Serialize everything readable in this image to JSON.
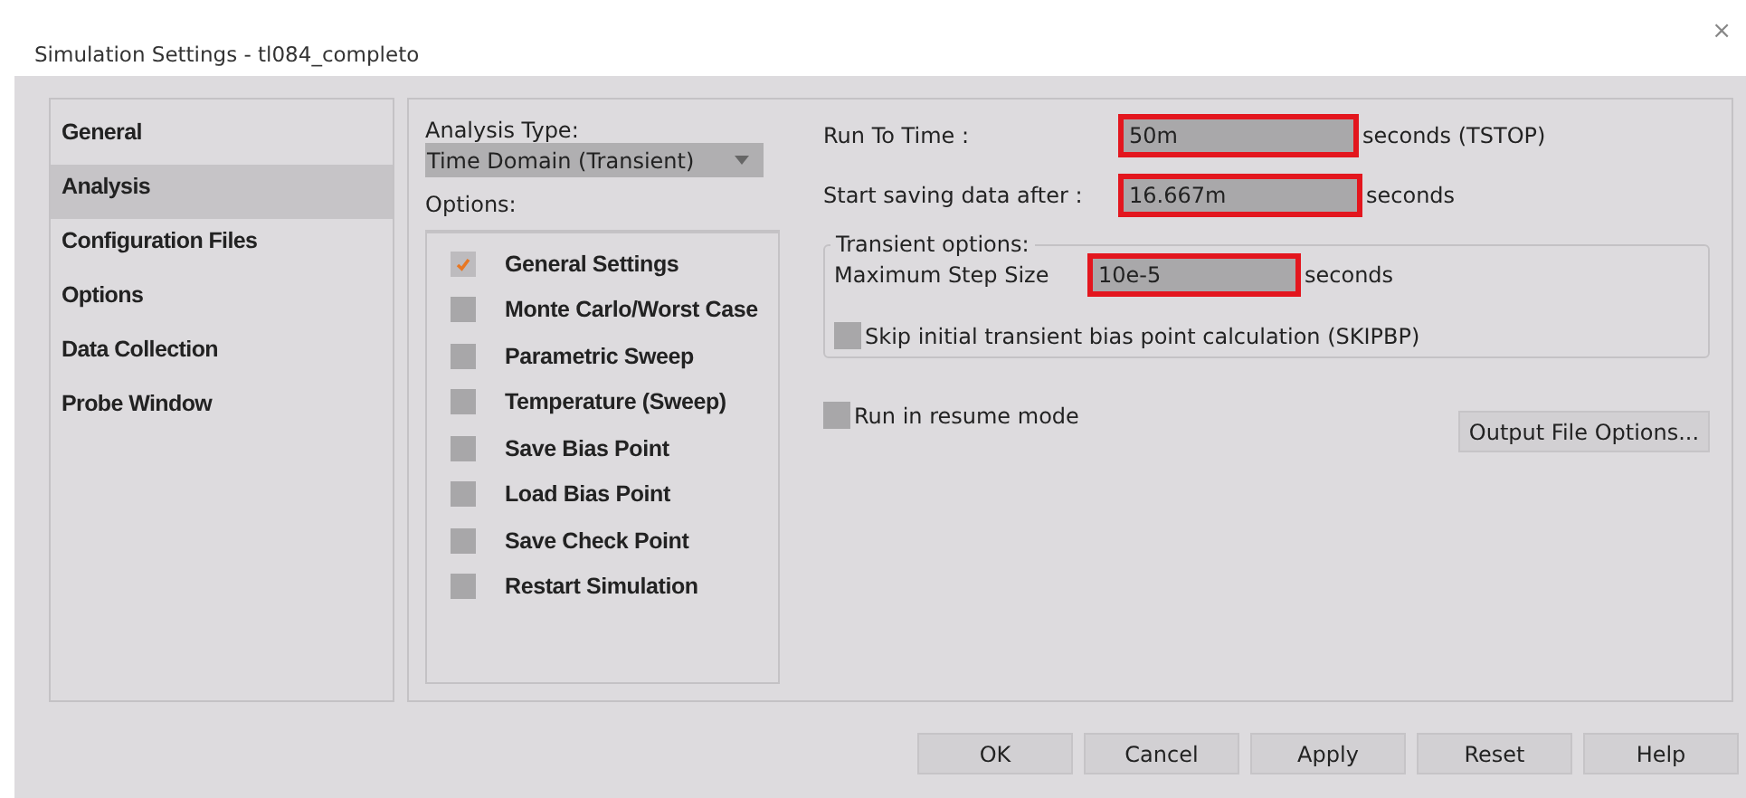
{
  "window": {
    "title": "Simulation Settings - tl084_completo",
    "close": "×"
  },
  "sidebar": {
    "items": [
      {
        "label": "General",
        "selected": false
      },
      {
        "label": "Analysis",
        "selected": true
      },
      {
        "label": "Configuration Files",
        "selected": false
      },
      {
        "label": "Options",
        "selected": false
      },
      {
        "label": "Data Collection",
        "selected": false
      },
      {
        "label": "Probe Window",
        "selected": false
      }
    ]
  },
  "analysis_type": {
    "label": "Analysis Type:",
    "value": "Time Domain (Transient)"
  },
  "options": {
    "label": "Options:",
    "items": [
      {
        "label": "General Settings",
        "checked": true
      },
      {
        "label": "Monte Carlo/Worst Case",
        "checked": false
      },
      {
        "label": "Parametric Sweep",
        "checked": false
      },
      {
        "label": "Temperature (Sweep)",
        "checked": false
      },
      {
        "label": "Save Bias Point",
        "checked": false
      },
      {
        "label": "Load Bias Point",
        "checked": false
      },
      {
        "label": "Save Check Point",
        "checked": false
      },
      {
        "label": "Restart Simulation",
        "checked": false
      }
    ]
  },
  "run_to_time": {
    "label": "Run To Time :",
    "value": "50m",
    "unit": "seconds (TSTOP)",
    "highlighted": true
  },
  "start_saving": {
    "label": "Start saving data after :",
    "value": "16.667m",
    "unit": "seconds",
    "highlighted": true
  },
  "transient_options": {
    "title": "Transient options:",
    "max_step": {
      "label": "Maximum Step Size",
      "value": "10e-5",
      "unit": "seconds",
      "highlighted": true
    },
    "skip_bias": {
      "label": "Skip initial transient bias point calculation (SKIPBP)",
      "checked": false
    }
  },
  "resume_mode": {
    "label": "Run in resume mode",
    "checked": false
  },
  "output_file_options": "Output File Options...",
  "buttons": [
    "OK",
    "Cancel",
    "Apply",
    "Reset",
    "Help"
  ]
}
